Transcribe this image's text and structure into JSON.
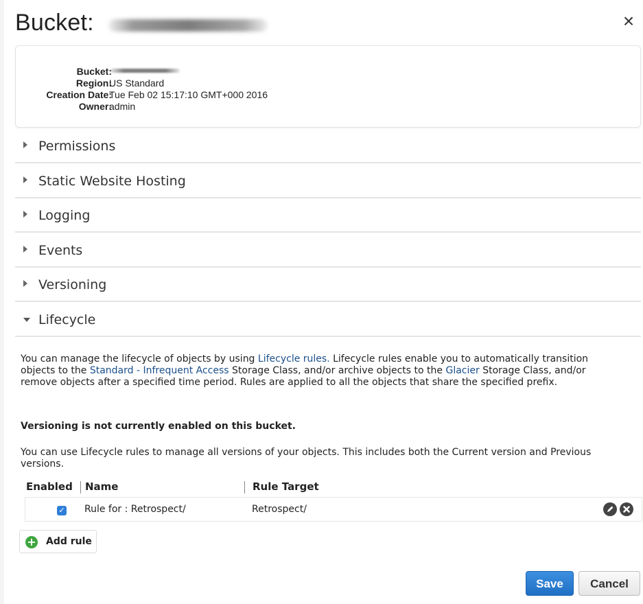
{
  "panel": {
    "title": "Bucket:",
    "close_label": "×"
  },
  "info": {
    "bucket_label": "Bucket:",
    "region_label": "Region:",
    "region_value": "US Standard",
    "creation_label": "Creation Date:",
    "creation_value": "Tue Feb 02 15:17:10 GMT+000 2016",
    "owner_label": "Owner:",
    "owner_value": "admin"
  },
  "sections": {
    "permissions": "Permissions",
    "static_hosting": "Static Website Hosting",
    "logging": "Logging",
    "events": "Events",
    "versioning": "Versioning",
    "lifecycle": "Lifecycle"
  },
  "lifecycle": {
    "p1_a": "You can manage the lifecycle of objects by using ",
    "p1_link1": "Lifecycle rules.",
    "p1_b": " Lifecycle rules enable you to automatically transition objects to the ",
    "p1_link2": "Standard - Infrequent Access",
    "p1_c": " Storage Class, and/or archive objects to the ",
    "p1_link3": "Glacier",
    "p1_d": " Storage Class, and/or remove objects after a specified time period. Rules are applied to all the objects that share the specified prefix.",
    "versioning_note": "Versioning is not currently enabled on this bucket.",
    "p2": "You can use Lifecycle rules to manage all versions of your objects. This includes both the Current version and Previous versions.",
    "columns": {
      "enabled": "Enabled",
      "name": "Name",
      "target": "Rule Target"
    },
    "rules": [
      {
        "enabled": true,
        "name": "Rule for : Retrospect/",
        "target": "Retrospect/"
      }
    ],
    "add_rule": "Add rule"
  },
  "footer": {
    "save": "Save",
    "cancel": "Cancel"
  },
  "icons": {
    "close": "close-icon",
    "edit": "pencil-icon",
    "delete": "x-circle-icon",
    "add": "plus-circle-icon",
    "expand": "triangle-right-icon",
    "collapse": "triangle-down-icon"
  },
  "colors": {
    "link": "#1a4f8b",
    "primary_button": "#2a7ad2",
    "checkbox": "#2f7fd8",
    "add_icon": "#3fa63f"
  }
}
